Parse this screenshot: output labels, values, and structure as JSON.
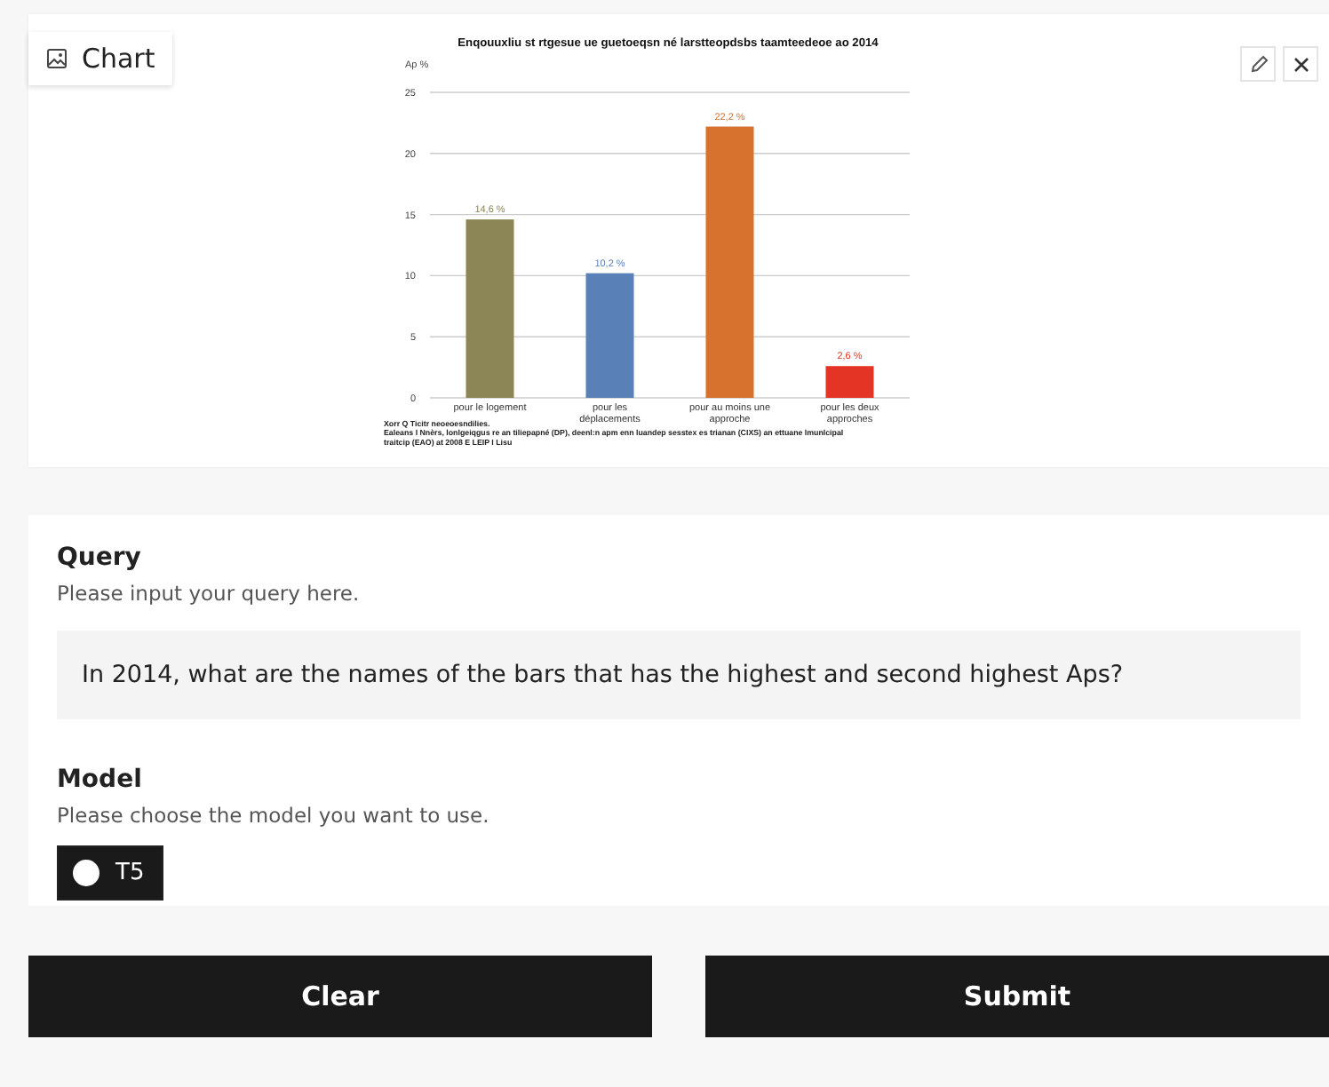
{
  "chart_panel": {
    "label": "Chart",
    "chart_data": {
      "type": "bar",
      "title": "Enqouuxliu st rtgesue ue guetoeqsn né larstteopdsbs taamteedeoe ao 2014",
      "ylabel": "Ap %",
      "categories": [
        "pour le logement",
        "pour les déplacements",
        "pour au moins une approche",
        "pour les deux approches"
      ],
      "values": [
        14.6,
        10.2,
        22.2,
        2.6
      ],
      "grid": true,
      "colors": [
        "#8c8555",
        "#5a80b8",
        "#d6722d",
        "#e33426"
      ],
      "value_labels": [
        "14,6 %",
        "10,2 %",
        "22,2 %",
        "2,6 %"
      ],
      "ylim": [
        0,
        25
      ],
      "yticks": [
        0,
        5,
        10,
        15,
        20,
        25
      ]
    },
    "notes": [
      "Xorr Q Ticitr neoeoesndilies.",
      "Ealeans l Nnèrs, lonlgeiqgus re an tiliepapné (DP), deenl:n apm enn luandep sesstex es trianan (CIXS) an ettuane lmunlcipal",
      "traitcip (EAO) at 2008 E LEIP I Lisu"
    ]
  },
  "query": {
    "title": "Query",
    "hint": "Please input your query here.",
    "value": "In 2014, what are the names of the bars that has the highest and second highest Aps?"
  },
  "model": {
    "title": "Model",
    "hint": "Please choose the model you want to use.",
    "options": [
      {
        "label": "T5",
        "selected": true
      }
    ]
  },
  "buttons": [
    "Clear",
    "Submit"
  ]
}
